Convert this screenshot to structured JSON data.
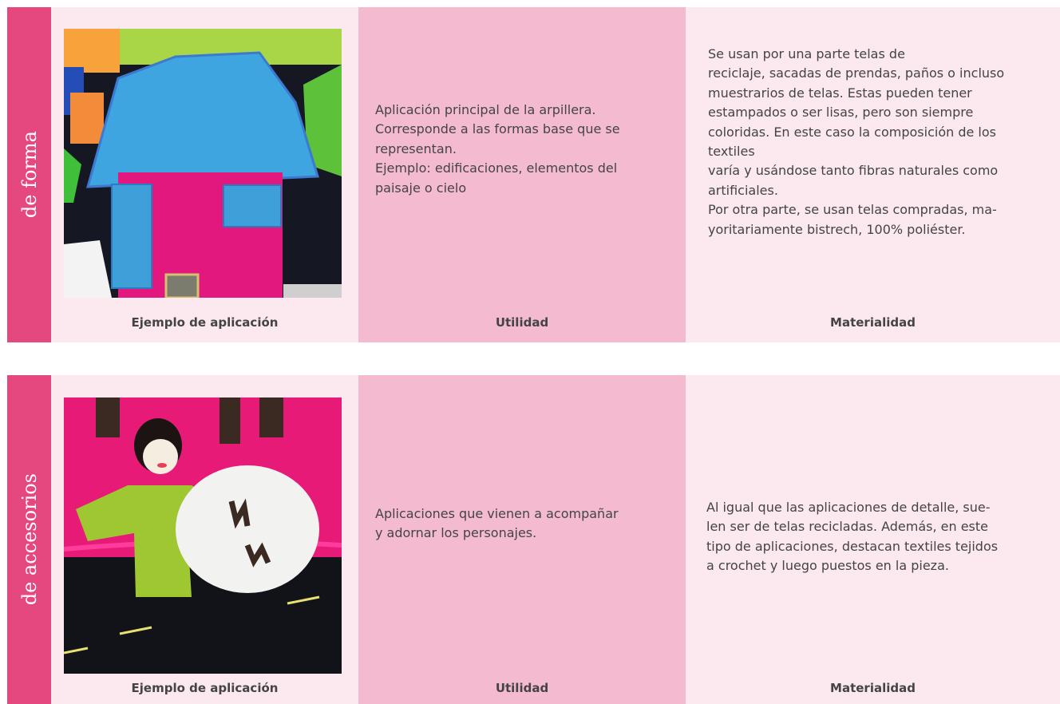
{
  "sections": [
    {
      "side_label": "de forma",
      "image_caption": "Ejemplo de aplicación",
      "utilidad_caption": "Utilidad",
      "utilidad_lines": [
        "Aplicación principal de la arpillera.",
        "Corresponde a las formas base que se",
        "representan.",
        "Ejemplo: edificaciones, elementos del",
        "paisaje o cielo"
      ],
      "materialidad_caption": "Materialidad",
      "materialidad_lines": [
        "Se usan por una parte telas de",
        "reciclaje, sacadas de prendas, paños o incluso",
        "muestrarios de telas. Estas pueden tener",
        "estampados o ser lisas, pero son siempre",
        "coloridas. En este caso la composición de los",
        "textiles",
        "varía y usándose tanto fibras naturales como",
        "artificiales.",
        "Por otra parte, se usan telas compradas, ma-",
        "yoritariamente bistrech, 100% poliéster."
      ]
    },
    {
      "side_label": "de accesorios",
      "image_caption": "Ejemplo de aplicación",
      "utilidad_caption": "Utilidad",
      "utilidad_lines": [
        "Aplicaciones que vienen a acompañar",
        "y adornar los personajes."
      ],
      "materialidad_caption": "Materialidad",
      "materialidad_lines": [
        "Al igual que las aplicaciones de detalle, sue-",
        "len ser de telas recicladas. Además, en este",
        "tipo de aplicaciones, destacan textiles tejidos",
        "a crochet y luego puestos en la pieza."
      ]
    }
  ]
}
